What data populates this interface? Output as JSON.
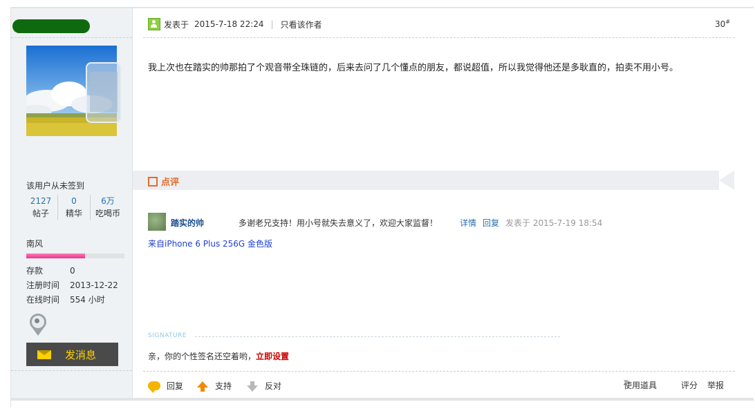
{
  "user": {
    "sign_status": "该用户从未签到",
    "stats": [
      {
        "value": "2127",
        "label": "帖子"
      },
      {
        "value": "0",
        "label": "精华"
      },
      {
        "value": "6万",
        "label": "吃喝币"
      }
    ],
    "group": "南风",
    "level_progress": 0.6,
    "info": [
      {
        "key": "存款",
        "value": "0"
      },
      {
        "key": "注册时间",
        "value": "2013-12-22"
      },
      {
        "key": "在线时间",
        "value": "554 小时"
      }
    ],
    "message_button": "发消息"
  },
  "post": {
    "posted_prefix": "发表于",
    "date": "2015-7-18 22:24",
    "divider": "|",
    "only_author": "只看该作者",
    "floor": "30",
    "floor_mark": "#",
    "content": "我上次也在踏实的帅那拍了个观音带全珠链的，后来去问了几个懂点的朋友，都说超值，所以我觉得他还是多耿直的，拍卖不用小号。"
  },
  "comment": {
    "tab_label": "点评",
    "user": "踏实的帅",
    "text": "多谢老兄支持！用小号就失去意义了，欢迎大家监督！",
    "detail_link": "详情",
    "reply_link": "回复",
    "time": "发表于  2015-7-19 18:54"
  },
  "from_device": "来自iPhone 6 Plus 256G 金色版",
  "signature": {
    "label": "SIGNATURE",
    "text": "亲，你的个性签名还空着哟，",
    "link": "立即设置"
  },
  "actions": {
    "reply": "回复",
    "support": "支持",
    "oppose": "反对",
    "tools": "使用道具",
    "tools_caret": "▼",
    "rate": "评分",
    "report": "举报"
  },
  "colors": {
    "accent_green": "#0f6a0f",
    "link_blue": "#2a6fb0",
    "comment_orange": "#e26b2b",
    "signature_red": "#cc0000"
  }
}
